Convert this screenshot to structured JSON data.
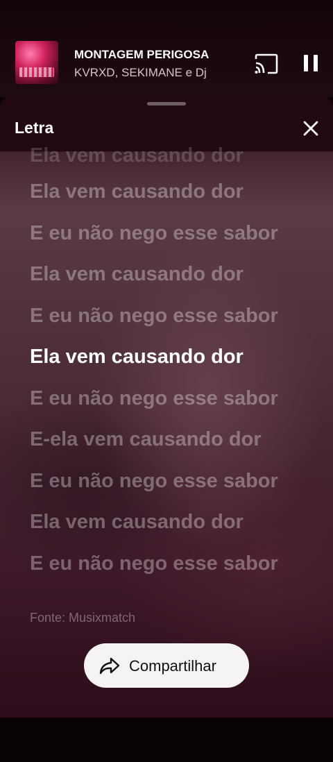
{
  "player": {
    "title": "MONTAGEM PERIGOSA",
    "artists": "KVRXD, SEKIMANE e Dj"
  },
  "sheet": {
    "title": "Letra",
    "lyrics": [
      "Ela vem causando dor",
      "Ela vem causando dor",
      "E eu não nego esse sabor",
      "Ela vem causando dor",
      "E eu não nego esse sabor",
      "Ela vem causando dor",
      "E eu não nego esse sabor",
      "E-ela vem causando dor",
      "E eu não nego esse sabor",
      "Ela vem causando dor",
      "E eu não nego esse sabor"
    ],
    "active_line": "Ela vem causando dor",
    "source": "Fonte: Musixmatch",
    "share_label": "Compartilhar"
  },
  "icons": {
    "cast": "cast-icon",
    "pause": "pause-icon",
    "close": "close-icon",
    "share": "share-icon"
  }
}
